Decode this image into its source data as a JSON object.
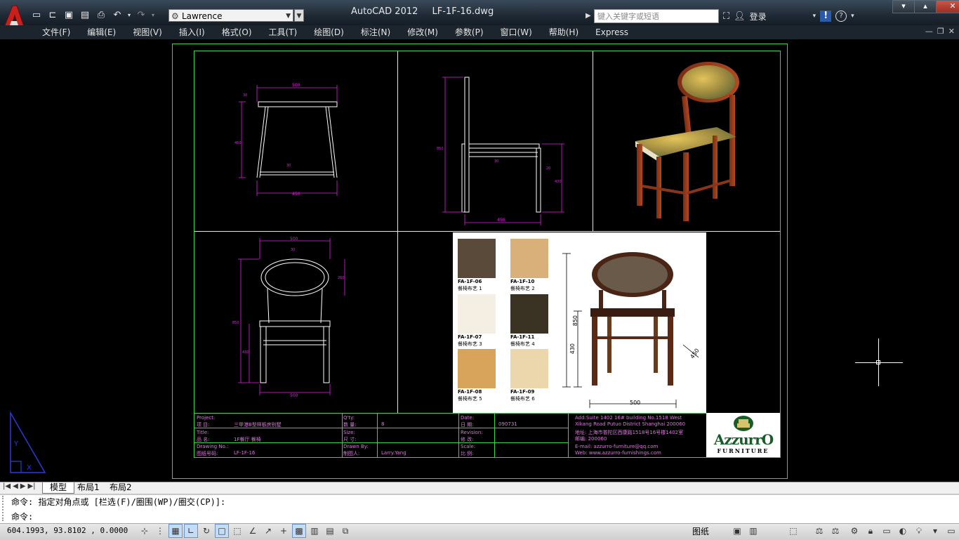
{
  "app": {
    "name": "AutoCAD 2012",
    "file": "LF-1F-16.dwg",
    "workspace": "Lawrence",
    "search_placeholder": "键入关键字或短语",
    "login": "登录"
  },
  "menu": [
    "文件(F)",
    "编辑(E)",
    "视图(V)",
    "插入(I)",
    "格式(O)",
    "工具(T)",
    "绘图(D)",
    "标注(N)",
    "修改(M)",
    "参数(P)",
    "窗口(W)",
    "帮助(H)",
    "Express"
  ],
  "drawing": {
    "front_dims": {
      "top": "500",
      "thick": "30",
      "height": "450",
      "bottom": "450",
      "mid": "30"
    },
    "side_dims": {
      "height": "850",
      "seat": "430",
      "depth": "450",
      "mid": "30",
      "rail": "20"
    },
    "back_dims": {
      "top": "500",
      "oval": "260",
      "height": "850",
      "seat": "430",
      "bottom": "500",
      "thick": "30"
    },
    "swatches": [
      {
        "code": "FA-1F-06",
        "name": "餐椅布艺 1",
        "color": "#5a4a3a"
      },
      {
        "code": "FA-1F-10",
        "name": "餐椅布艺 2",
        "color": "#d9b07a"
      },
      {
        "code": "FA-1F-07",
        "name": "餐椅布艺 3",
        "color": "#f4efe2"
      },
      {
        "code": "FA-1F-11",
        "name": "餐椅布艺 4",
        "color": "#3a3222"
      },
      {
        "code": "FA-1F-08",
        "name": "餐椅布艺 5",
        "color": "#d8a45c"
      },
      {
        "code": "FA-1F-09",
        "name": "餐椅布艺 6",
        "color": "#ecd6ac"
      }
    ],
    "photo_dims": {
      "height": "850",
      "seat": "430",
      "depth": "450",
      "width": "500"
    }
  },
  "titleblock": {
    "project_en": "Project:",
    "project_cn": "项    目:",
    "project_val": "三甲港B型样板房别墅",
    "qty_en": "Q'ty:",
    "qty_cn": "数    量:",
    "qty_val": "8",
    "date_en": "Date:",
    "date_cn": "日    期:",
    "date_val": "090731",
    "title_en": "Title:",
    "title_cn": "品    名:",
    "title_val": "1F餐厅      餐椅",
    "size_en": "Size:",
    "size_cn": "尺    寸:",
    "rev_en": "Revision:",
    "rev_cn": "修    改:",
    "dwg_en": "Drawing No.:",
    "dwg_cn": "图纸号码:",
    "dwg_val": "LF-1F-16",
    "drawn_en": "Drawn By:",
    "drawn_cn": "制图人:",
    "drawn_val": "Larry.Yang",
    "scale_en": "Scale:",
    "scale_cn": "比    例:",
    "addr_en1": "Add:Suite 1402 16# building No.1518 West",
    "addr_en2": "Xikang Road Putuo District Shanghai 200060",
    "addr_cn1": "地址: 上海市普陀区西康路1518号16号楼1402室",
    "addr_cn2": "邮编: 200060",
    "email": "E-mail: azzurro-furniture@qq.com",
    "web": "Web: www.azzurro-furnishings.com",
    "brand": "AzzurrO",
    "brand_sub": "FURNITURE"
  },
  "tabs": {
    "model": "模型",
    "layout1": "布局1",
    "layout2": "布局2"
  },
  "command": {
    "line1": "命令: 指定对角点或 [栏选(F)/圈围(WP)/圈交(CP)]:",
    "line2": "命令:"
  },
  "status": {
    "coords": "604.1993, 93.8102 , 0.0000",
    "paper": "图纸"
  }
}
